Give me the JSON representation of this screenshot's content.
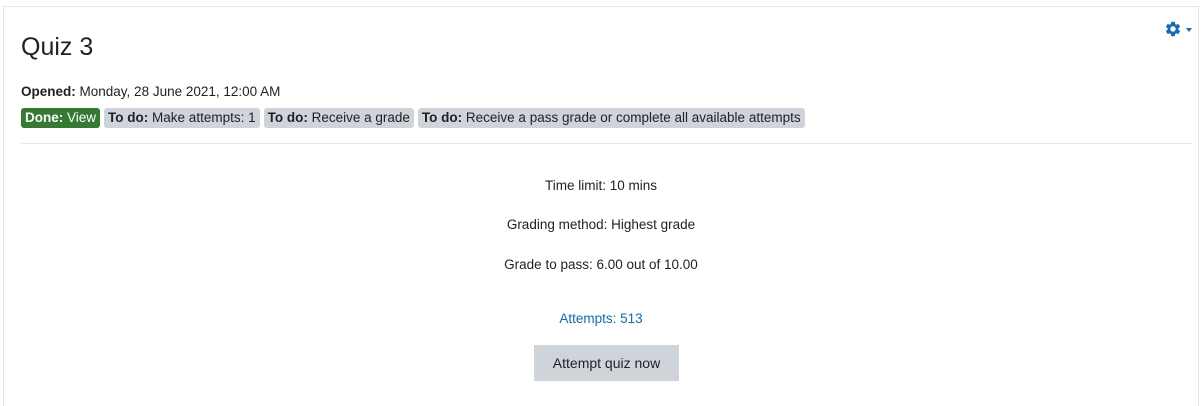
{
  "activity": {
    "title": "Quiz 3",
    "opened_label": "Opened:",
    "opened_value": "Monday, 28 June 2021, 12:00 AM"
  },
  "completion": [
    {
      "status": "Done:",
      "text": "View",
      "state": "done"
    },
    {
      "status": "To do:",
      "text": "Make attempts: 1",
      "state": "todo"
    },
    {
      "status": "To do:",
      "text": "Receive a grade",
      "state": "todo"
    },
    {
      "status": "To do:",
      "text": "Receive a pass grade or complete all available attempts",
      "state": "todo"
    }
  ],
  "quiz_info": {
    "time_limit": "Time limit: 10 mins",
    "grading_method": "Grading method: Highest grade",
    "grade_to_pass": "Grade to pass: 6.00 out of 10.00"
  },
  "attempts_link": "Attempts: 513",
  "attempt_button": "Attempt quiz now",
  "settings_menu": {
    "icon": "gear-icon"
  },
  "colors": {
    "accent": "#0f6cbf",
    "done_badge": "#357a32",
    "todo_badge": "#ced4da",
    "button": "#ced4da"
  }
}
